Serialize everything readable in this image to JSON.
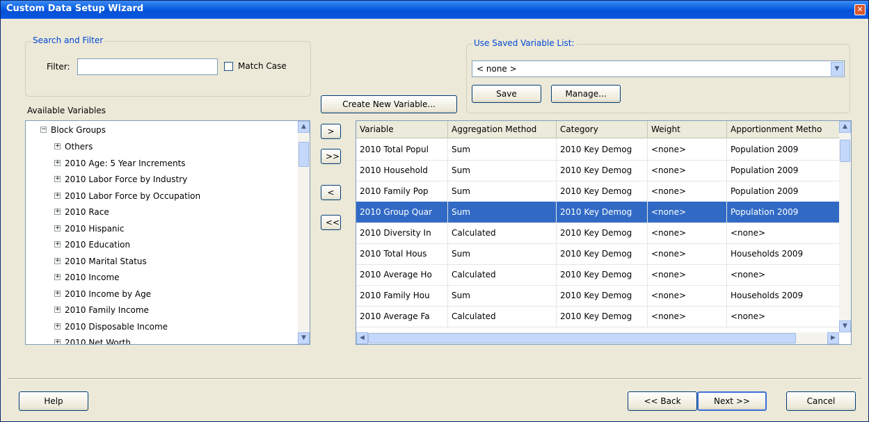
{
  "window": {
    "title": "Custom Data Setup Wizard"
  },
  "search_filter": {
    "legend": "Search and Filter",
    "filter_label": "Filter:",
    "filter_value": "",
    "match_case_label": "Match Case"
  },
  "saved_list": {
    "legend": "Use Saved Variable List:",
    "selected": "< none >",
    "save_label": "Save",
    "manage_label": "Manage..."
  },
  "create_variable_label": "Create New Variable...",
  "available": {
    "label": "Available Variables",
    "root": "Block Groups",
    "items": [
      "Others",
      "2010 Age: 5 Year Increments",
      "2010 Labor Force by Industry",
      "2010 Labor Force by Occupation",
      "2010 Race",
      "2010 Hispanic",
      "2010 Education",
      "2010 Marital Status",
      "2010 Income",
      "2010 Income by Age",
      "2010 Family Income",
      "2010 Disposable Income",
      "2010 Net Worth"
    ]
  },
  "transfer": {
    "add": ">",
    "add_all": ">>",
    "remove": "<",
    "remove_all": "<<"
  },
  "selected_grid": {
    "columns": [
      "Variable",
      "Aggregation Method",
      "Category",
      "Weight",
      "Apportionment Metho"
    ],
    "rows": [
      [
        "2010 Total Popul",
        "Sum",
        "2010 Key Demog",
        "<none>",
        "Population 2009"
      ],
      [
        "2010 Household",
        "Sum",
        "2010 Key Demog",
        "<none>",
        "Population 2009"
      ],
      [
        "2010 Family Pop",
        "Sum",
        "2010 Key Demog",
        "<none>",
        "Population 2009"
      ],
      [
        "2010 Group Quar",
        "Sum",
        "2010 Key Demog",
        "<none>",
        "Population 2009"
      ],
      [
        "2010 Diversity In",
        "Calculated",
        "2010 Key Demog",
        "<none>",
        "<none>"
      ],
      [
        "2010 Total Hous",
        "Sum",
        "2010 Key Demog",
        "<none>",
        "Households 2009"
      ],
      [
        "2010 Average Ho",
        "Calculated",
        "2010 Key Demog",
        "<none>",
        "<none>"
      ],
      [
        "2010 Family Hou",
        "Sum",
        "2010 Key Demog",
        "<none>",
        "Households 2009"
      ],
      [
        "2010 Average Fa",
        "Calculated",
        "2010 Key Demog",
        "<none>",
        "<none>"
      ]
    ],
    "selected_row_index": 3
  },
  "footer": {
    "help": "Help",
    "back": "<< Back",
    "next": "Next >>",
    "cancel": "Cancel"
  }
}
